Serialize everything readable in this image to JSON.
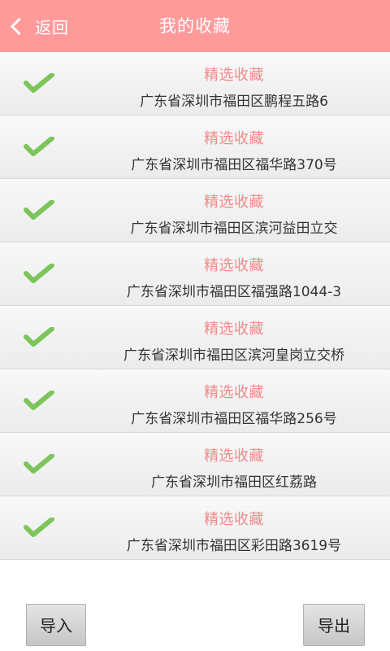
{
  "header": {
    "back_label": "返回",
    "title": "我的收藏"
  },
  "items": [
    {
      "title": "精选收藏",
      "address": "广东省深圳市福田区鹏程五路6",
      "checked": true
    },
    {
      "title": "精选收藏",
      "address": "广东省深圳市福田区福华路370号",
      "checked": true
    },
    {
      "title": "精选收藏",
      "address": "广东省深圳市福田区滨河益田立交",
      "checked": true
    },
    {
      "title": "精选收藏",
      "address": "广东省深圳市福田区福强路1044-3",
      "checked": true
    },
    {
      "title": "精选收藏",
      "address": "广东省深圳市福田区滨河皇岗立交桥",
      "checked": true
    },
    {
      "title": "精选收藏",
      "address": "广东省深圳市福田区福华路256号",
      "checked": true
    },
    {
      "title": "精选收藏",
      "address": "广东省深圳市福田区红荔路",
      "checked": true
    },
    {
      "title": "精选收藏",
      "address": "广东省深圳市福田区彩田路3619号",
      "checked": true
    }
  ],
  "footer": {
    "import_label": "导入",
    "export_label": "导出"
  },
  "colors": {
    "header_bg": "#ff9a9a",
    "item_title": "#f08a8a",
    "check": "#7cc55a"
  },
  "icons": {
    "back": "chevron-left-icon",
    "check": "check-icon"
  }
}
